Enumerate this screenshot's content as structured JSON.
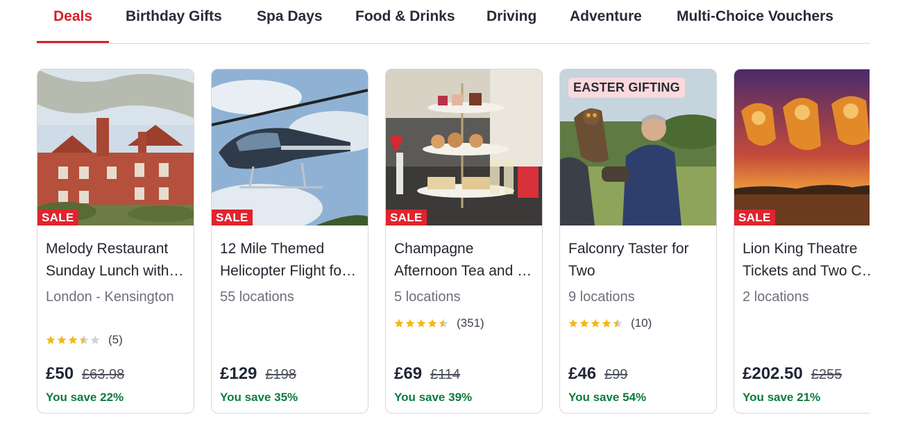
{
  "nav": {
    "tabs": [
      {
        "label": "Deals",
        "active": true
      },
      {
        "label": "Birthday Gifts"
      },
      {
        "label": "Spa Days"
      },
      {
        "label": "Food & Drinks"
      },
      {
        "label": "Driving"
      },
      {
        "label": "Adventure"
      },
      {
        "label": "Multi-Choice Vouchers"
      }
    ],
    "active_color": "#d6202a"
  },
  "cards": [
    {
      "title_line1": "Melody Restaurant",
      "title_line2": "Sunday Lunch with Prosecco for Two",
      "location": "London - Kensington",
      "rating": 3.5,
      "rating_count": "(5)",
      "price": "£50",
      "was_price": "£63.98",
      "save_text": "You save 22%",
      "badge": "SALE",
      "image_icon": "red-brick-mansion-photo"
    },
    {
      "title_line1": "12 Mile Themed",
      "title_line2": "Helicopter Flight for One",
      "location": "55 locations",
      "price": "£129",
      "was_price": "£198",
      "save_text": "You save 35%",
      "badge": "SALE",
      "image_icon": "helicopter-photo"
    },
    {
      "title_line1": "Champagne",
      "title_line2": "Afternoon Tea and More for Two",
      "location": "5 locations",
      "rating": 4.5,
      "rating_count": "(351)",
      "price": "£69",
      "was_price": "£114",
      "save_text": "You save 39%",
      "badge": "SALE",
      "image_icon": "afternoon-tea-photo"
    },
    {
      "title_line1": "Falconry Taster for",
      "title_line2": "Two",
      "location": "9 locations",
      "rating": 4.5,
      "rating_count": "(10)",
      "price": "£46",
      "was_price": "£99",
      "save_text": "You save 54%",
      "badge": "EASTER GIFTING",
      "image_icon": "falconry-owl-photo"
    },
    {
      "title_line1": "Lion King Theatre",
      "title_line2": "Tickets and Two Course Meal",
      "location": "2 locations",
      "price": "£202.50",
      "was_price": "£255",
      "save_text": "You save 21%",
      "badge": "SALE",
      "image_icon": "lion-king-stage-photo"
    }
  ],
  "colors": {
    "sale_badge": "#e0242d",
    "easter_badge": "#fbd9dc",
    "save_text": "#0d7a3d",
    "star_filled": "#f5b71b",
    "star_empty": "#cfd2d8"
  }
}
